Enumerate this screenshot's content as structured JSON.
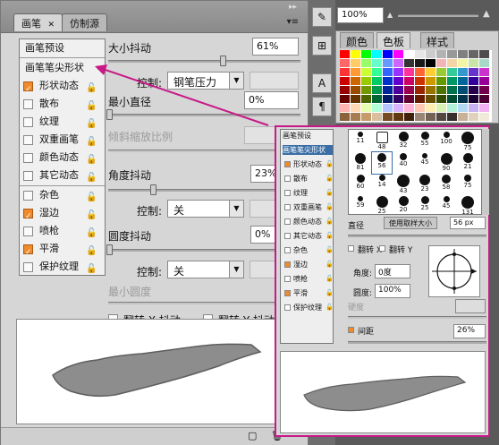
{
  "tabs": [
    {
      "label": "画笔"
    },
    {
      "label": "仿制源"
    }
  ],
  "brush_list": [
    {
      "label": "画笔预设",
      "type": "header"
    },
    {
      "label": "画笔笔尖形状",
      "type": "header"
    },
    {
      "label": "形状动态",
      "checked": true,
      "lock": true
    },
    {
      "label": "散布",
      "checked": false,
      "lock": true
    },
    {
      "label": "纹理",
      "checked": false,
      "lock": true
    },
    {
      "label": "双重画笔",
      "checked": false,
      "lock": true
    },
    {
      "label": "颜色动态",
      "checked": false,
      "lock": true
    },
    {
      "label": "其它动态",
      "checked": false,
      "lock": true
    },
    {
      "label": "杂色",
      "checked": false,
      "lock": true
    },
    {
      "label": "湿边",
      "checked": true,
      "lock": true
    },
    {
      "label": "喷枪",
      "checked": false,
      "lock": true
    },
    {
      "label": "平滑",
      "checked": true,
      "lock": true
    },
    {
      "label": "保护纹理",
      "checked": false,
      "lock": true
    }
  ],
  "settings": {
    "size_jitter_label": "大小抖动",
    "size_jitter_value": "61%",
    "control_label": "控制:",
    "control1_value": "钢笔压力",
    "min_diameter_label": "最小直径",
    "min_diameter_value": "0%",
    "tilt_scale_label": "倾斜缩放比例",
    "angle_jitter_label": "角度抖动",
    "angle_jitter_value": "23%",
    "control2_value": "关",
    "roundness_jitter_label": "圆度抖动",
    "roundness_jitter_value": "0%",
    "control3_value": "关",
    "min_roundness_label": "最小圆度",
    "flip_x_label": "翻转 X 抖动",
    "flip_y_label": "翻转 Y 抖动"
  },
  "right_dock": {
    "zoom_value": "100%",
    "swatch_tabs": [
      "颜色",
      "色板",
      "样式"
    ]
  },
  "inset": {
    "list": [
      {
        "label": "画笔预设"
      },
      {
        "label": "画笔笔尖形状",
        "selected": true
      },
      {
        "label": "形状动态",
        "checked": true
      },
      {
        "label": "散布",
        "checked": false
      },
      {
        "label": "纹理",
        "checked": false
      },
      {
        "label": "双重画笔",
        "checked": false
      },
      {
        "label": "颜色动态",
        "checked": false
      },
      {
        "label": "其它动态",
        "checked": false
      },
      {
        "label": "杂色",
        "checked": false
      },
      {
        "label": "湿边",
        "checked": true
      },
      {
        "label": "喷枪",
        "checked": false
      },
      {
        "label": "平滑",
        "checked": true
      },
      {
        "label": "保护纹理",
        "checked": false
      }
    ],
    "brushes": [
      "11",
      "48",
      "32",
      "55",
      "100",
      "75",
      "81",
      "56",
      "40",
      "45",
      "90",
      "21",
      "60",
      "14",
      "43",
      "23",
      "58",
      "75",
      "59",
      "25",
      "20",
      "25",
      "45",
      "131"
    ],
    "diameter_label": "直径",
    "use_sample_label": "使用取样大小",
    "diameter_value": "56 px",
    "flip_x": "翻转 X",
    "flip_y": "翻转 Y",
    "angle_label": "角度:",
    "angle_value": "0度",
    "roundness_label": "圆度:",
    "roundness_value": "100%",
    "hardness_label": "硬度",
    "spacing_label": "间距",
    "spacing_value": "26%"
  }
}
